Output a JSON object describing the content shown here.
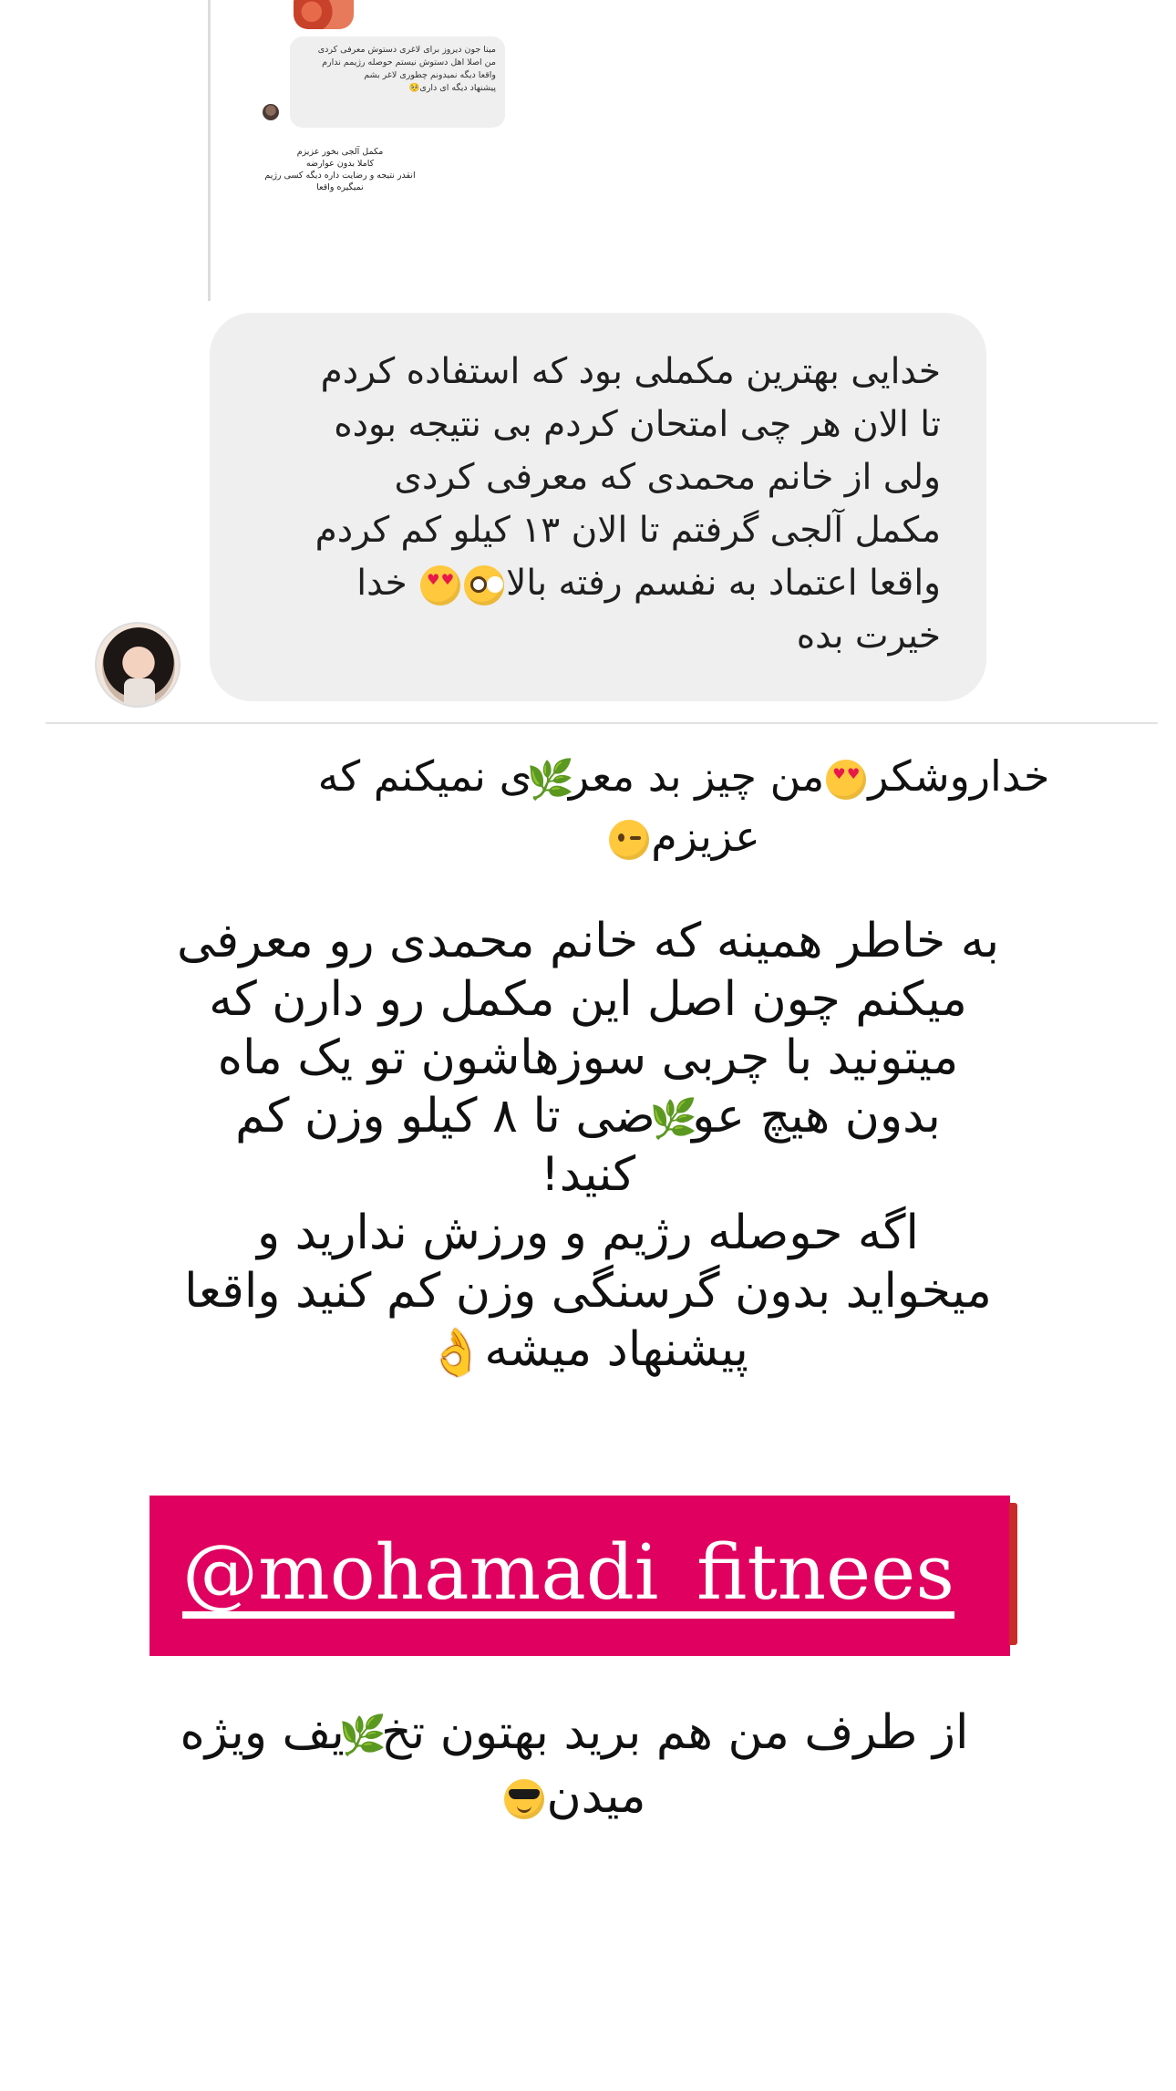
{
  "inset_comment": {
    "bubble_lines": [
      "مینا جون دیروز برای لاغری دستوش معرفی کردی",
      "من اصلا اهل دستوش نیستم حوصله رژیمم ندارم",
      "واقعا دیگه نمیدونم چطوری لاغر بشم",
      "پیشنهاد دیگه ای داری🥺"
    ],
    "reply_lines": [
      "مکمل آلجی بخور عزیزم",
      "کاملا بدون عوارضه",
      "انقدر نتیجه و رضایت داره دیگه کسی رژیم",
      "نمیگیره واقعا"
    ]
  },
  "dm_message": {
    "lines": [
      "خدایی بهترین مکملی بود که استفاده کردم",
      "تا الان هر چی امتحان کردم بی نتیجه بوده",
      "ولی از خانم محمدی که معرفی کردی",
      "مکمل آلجی گرفتم تا الان ۱۳ کیلو کم کردم",
      "واقعا اعتماد به نفسم رفته بالا",
      "خدا",
      "خیرت بده"
    ]
  },
  "story": {
    "block1": {
      "part1": "خداروشکر",
      "part2": "من چیز بد معر",
      "part3": "ی نمیکنم که",
      "line2": "عزیزم"
    },
    "block2": {
      "line1": "به خاطر همینه که خانم محمدی رو معرفی",
      "line2": "میکنم چون اصل این مکمل رو دارن که",
      "line3": "میتونید با چربی سوزهاشون تو یک ماه",
      "line4a": "بدون هیچ عو",
      "line4b": "ضی تا ۸ کیلو وزن کم",
      "line5": "کنید!",
      "line6": "اگه حوصله رژیم و ورزش ندارید و",
      "line7": "میخواید بدون گرسنگی وزن کم کنید واقعا",
      "line8": "پیشنهاد میشه"
    },
    "handle": "@mohamadi_fitnees",
    "block3": {
      "line1a": "از طرف من هم برید بهتون تخ",
      "line1b": "یف ویژه",
      "line2": "میدن"
    }
  },
  "colors": {
    "banner_bg": "#e0005f",
    "bubble_bg": "#efefef",
    "text": "#111111"
  },
  "icons": [
    "smiling-face-with-heart-eyes-icon",
    "pleading-face-icon",
    "winking-face-icon",
    "herb-icon",
    "ok-hand-icon",
    "sunglasses-face-icon"
  ]
}
